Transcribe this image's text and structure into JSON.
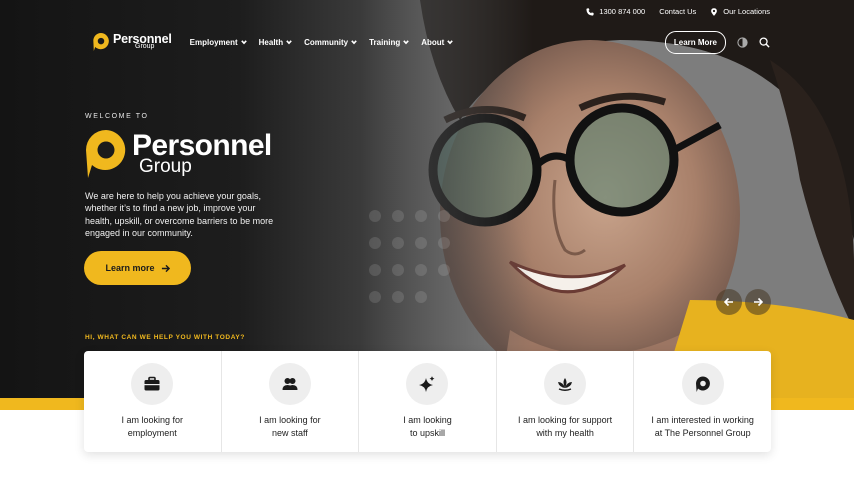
{
  "utility": {
    "phone": "1300 874 000",
    "contact": "Contact Us",
    "locations": "Our Locations"
  },
  "nav": {
    "logo_line1": "Personnel",
    "logo_line2": "Group",
    "items": [
      {
        "label": "Employment"
      },
      {
        "label": "Health"
      },
      {
        "label": "Community"
      },
      {
        "label": "Training"
      },
      {
        "label": "About"
      }
    ],
    "cta": "Learn More",
    "icons": [
      "contrast-icon",
      "search-icon"
    ]
  },
  "hero": {
    "welcome": "WELCOME TO",
    "logo_line1": "Personnel",
    "logo_line2": "Group",
    "intro": "We are here to help you achieve your goals, whether it’s to find a new job, improve your health, upskill, or overcome barriers to be more engaged in our community.",
    "button": "Learn more"
  },
  "help": {
    "heading": "HI, WHAT CAN WE HELP YOU WITH TODAY?",
    "cards": [
      {
        "icon": "briefcase-icon",
        "line1": "I am looking for",
        "line2": "employment"
      },
      {
        "icon": "people-icon",
        "line1": "I am looking for",
        "line2": "new staff"
      },
      {
        "icon": "sparkle-icon",
        "line1": "I am looking",
        "line2": "to upskill"
      },
      {
        "icon": "lotus-icon",
        "line1": "I am looking for support",
        "line2": "with my health"
      },
      {
        "icon": "personnel-logo-icon",
        "line1": "I am interested in working",
        "line2": "at The Personnel Group"
      }
    ]
  },
  "colors": {
    "accent": "#f0b81e",
    "dark": "#141414"
  }
}
